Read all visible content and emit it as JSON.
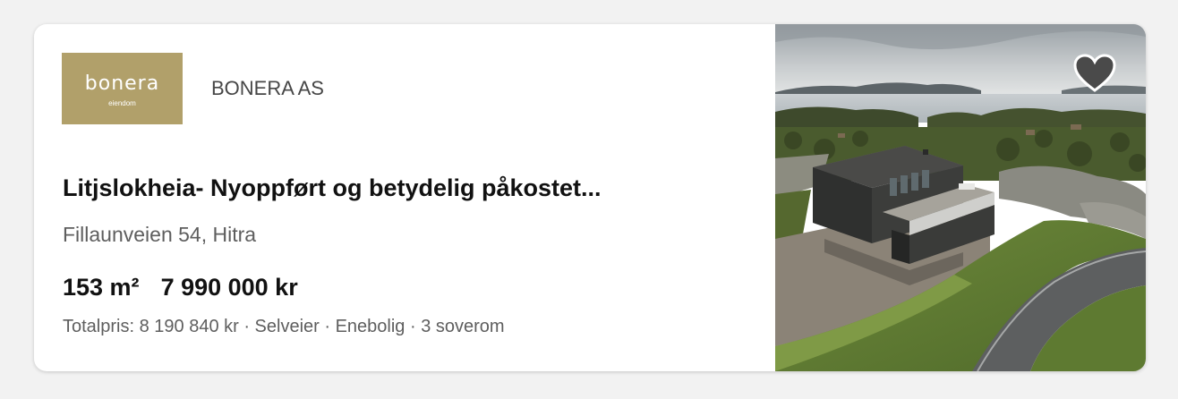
{
  "listing": {
    "agency": {
      "logo_word": "bonera",
      "logo_sub": "eiendom",
      "name": "BONERA AS"
    },
    "title": "Litjslokheia- Nyoppført og betydelig påkostet...",
    "address": "Fillaunveien 54, Hitra",
    "area": "153 m²",
    "price": "7 990 000 kr",
    "details": "Totalpris: 8 190 840 kr · Selveier · Enebolig · 3 soverom",
    "favorite_icon": "heart-icon",
    "colors": {
      "logo_bg": "#b1a06a",
      "text_primary": "#111111",
      "text_secondary": "#5e5e5e",
      "favorite": "#4a4a4a"
    }
  }
}
